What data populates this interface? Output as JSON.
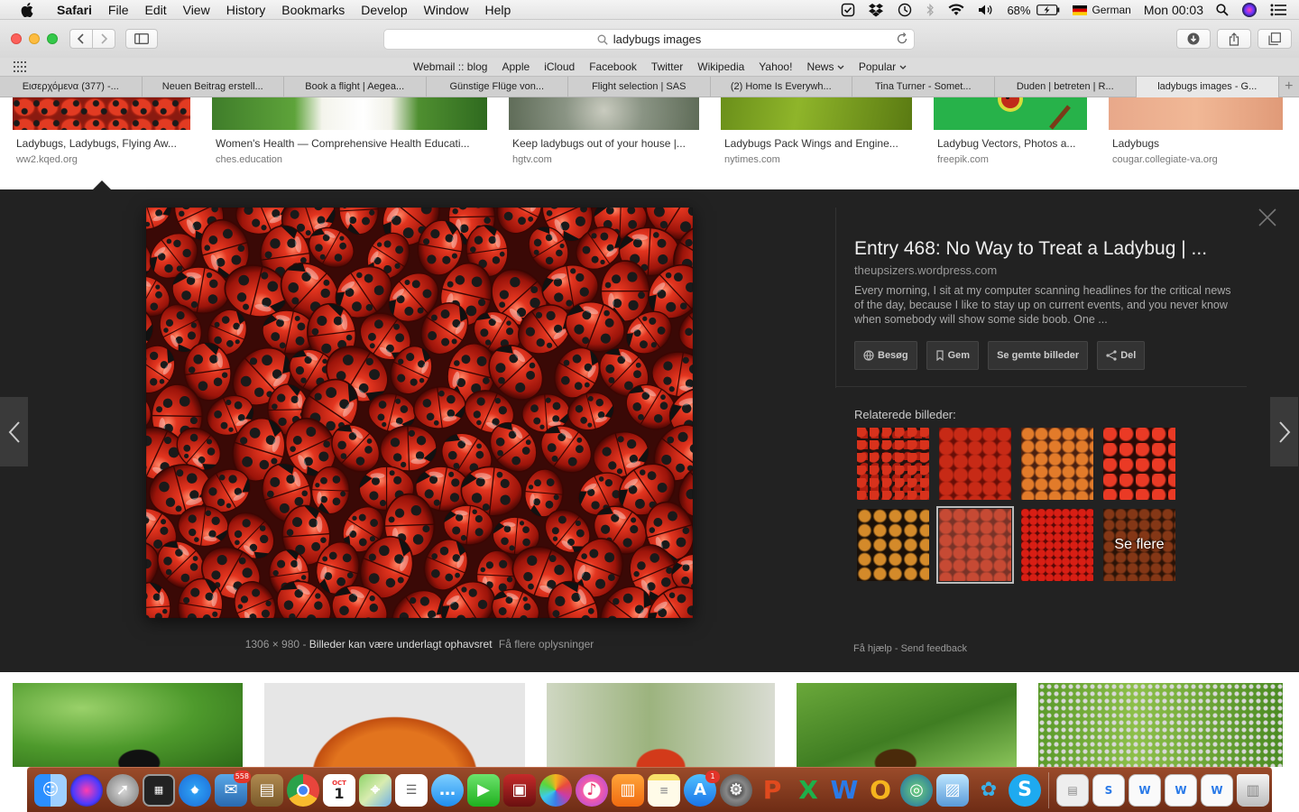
{
  "menubar": {
    "app": "Safari",
    "items": [
      "File",
      "Edit",
      "View",
      "History",
      "Bookmarks",
      "Develop",
      "Window",
      "Help"
    ],
    "battery": "68%",
    "input_source": "German",
    "clock": "Mon 00:03"
  },
  "toolbar": {
    "address": "ladybugs images"
  },
  "favorites": [
    "Webmail :: blog",
    "Apple",
    "iCloud",
    "Facebook",
    "Twitter",
    "Wikipedia",
    "Yahoo!",
    "News",
    "Popular"
  ],
  "tabs": [
    {
      "label": "Εισερχόμενα (377) -..."
    },
    {
      "label": "Neuen Beitrag erstell..."
    },
    {
      "label": "Book a flight | Aegea..."
    },
    {
      "label": "Günstige Flüge von..."
    },
    {
      "label": "Flight selection | SAS"
    },
    {
      "label": "(2) Home Is Everywh..."
    },
    {
      "label": "Tina Turner - Somet..."
    },
    {
      "label": "Duden | betreten | R..."
    },
    {
      "label": "ladybugs images - G..."
    }
  ],
  "results_top": [
    {
      "title": "Ladybugs, Ladybugs, Flying Aw...",
      "source": "ww2.kqed.org"
    },
    {
      "title": "Women's Health — Comprehensive Health Educati...",
      "source": "ches.education"
    },
    {
      "title": "Keep ladybugs out of your house |...",
      "source": "hgtv.com"
    },
    {
      "title": "Ladybugs Pack Wings and Engine...",
      "source": "nytimes.com"
    },
    {
      "title": "Ladybug Vectors, Photos a...",
      "source": "freepik.com"
    },
    {
      "title": "Ladybugs",
      "source": "cougar.collegiate-va.org"
    }
  ],
  "preview": {
    "title": "Entry 468: No Way to Treat a Ladybug | ...",
    "domain": "theupsizers.wordpress.com",
    "description": "Every morning, I sit at my computer scanning headlines for the critical news of the day, because I like to stay up on current events, and you never know when somebody will show some side boob. One ...",
    "buttons": {
      "visit": "Besøg",
      "save": "Gem",
      "saved": "Se gemte billeder",
      "share": "Del"
    },
    "related_label": "Relaterede billeder:",
    "see_more": "Se flere",
    "dimensions": "1306 × 980",
    "sep": "-",
    "copyright": "Billeder kan være underlagt ophavsret",
    "more_info": "Få flere oplysninger",
    "help": "Få hjælp",
    "feedback": "Send feedback"
  },
  "dock": {
    "mail_badge": "558",
    "calendar_month": "OCT",
    "calendar_day": "1",
    "appstore_badge": "1"
  },
  "colors": {
    "panel_bg": "#222222",
    "ladybug_red": "#d32a1a",
    "dock_bg": "#7e3419"
  }
}
